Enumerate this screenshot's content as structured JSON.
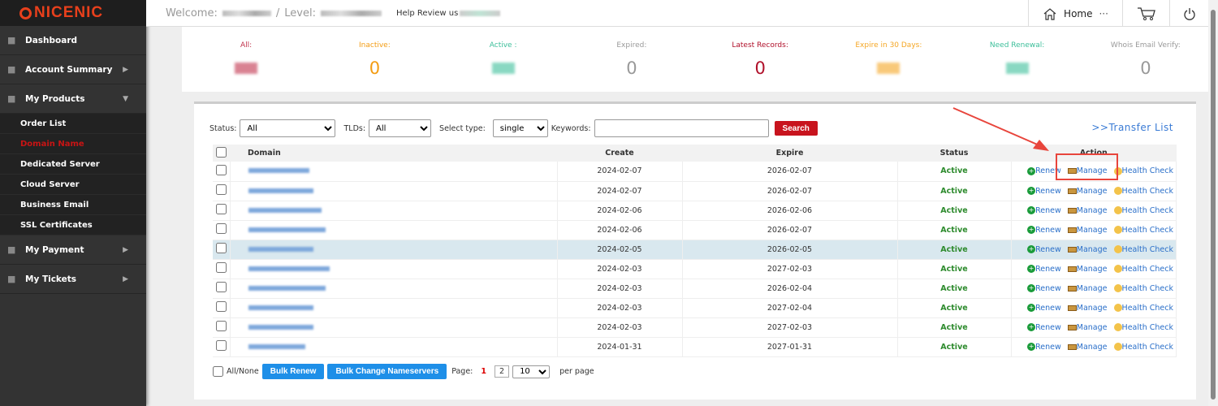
{
  "logo": "NICENIC",
  "header": {
    "welcome": "Welcome:",
    "level": "Level:",
    "help": "Help Review us",
    "home": "Home",
    "more": "···"
  },
  "sidebar": {
    "items": [
      {
        "label": "Dashboard",
        "icon": "monitor-icon"
      },
      {
        "label": "Account Summary",
        "icon": "user-icon"
      },
      {
        "label": "My Products",
        "icon": "basket-icon"
      }
    ],
    "sub": [
      "Order List",
      "Domain Name",
      "Dedicated Server",
      "Cloud Server",
      "Business Email",
      "SSL Certificates"
    ],
    "items2": [
      {
        "label": "My Payment",
        "icon": "money-bag-icon"
      },
      {
        "label": "My Tickets",
        "icon": "ticket-icon"
      }
    ]
  },
  "stats": [
    {
      "label": "All:",
      "value": null,
      "color": "#c0304a"
    },
    {
      "label": "Inactive:",
      "value": "0",
      "color": "#f39c12"
    },
    {
      "label": "Active :",
      "value": null,
      "color": "#3cbf9a"
    },
    {
      "label": "Expired:",
      "value": "0",
      "color": "#999999"
    },
    {
      "label": "Latest Records:",
      "value": "0",
      "color": "#b0102a"
    },
    {
      "label": "Expire in 30 Days:",
      "value": null,
      "color": "#f5a623"
    },
    {
      "label": "Need Renewal:",
      "value": null,
      "color": "#3cbf9a"
    },
    {
      "label": "Whois Email Verify:",
      "value": "0",
      "color": "#999999"
    }
  ],
  "filters": {
    "status_label": "Status:",
    "status": "All",
    "tlds_label": "TLDs:",
    "tlds": "All",
    "type_label": "Select type:",
    "type": "single",
    "keywords_label": "Keywords:",
    "keywords": "",
    "search": "Search",
    "transfer": ">>Transfer List"
  },
  "table": {
    "headers": [
      "Domain",
      "Create",
      "Expire",
      "Status",
      "Action"
    ],
    "rows": [
      {
        "create": "2024-02-07",
        "expire": "2026-02-07",
        "status": "Active"
      },
      {
        "create": "2024-02-07",
        "expire": "2026-02-07",
        "status": "Active"
      },
      {
        "create": "2024-02-06",
        "expire": "2026-02-06",
        "status": "Active"
      },
      {
        "create": "2024-02-06",
        "expire": "2026-02-07",
        "status": "Active"
      },
      {
        "create": "2024-02-05",
        "expire": "2026-02-05",
        "status": "Active"
      },
      {
        "create": "2024-02-03",
        "expire": "2027-02-03",
        "status": "Active"
      },
      {
        "create": "2024-02-03",
        "expire": "2026-02-04",
        "status": "Active"
      },
      {
        "create": "2024-02-03",
        "expire": "2027-02-04",
        "status": "Active"
      },
      {
        "create": "2024-02-03",
        "expire": "2027-02-03",
        "status": "Active"
      },
      {
        "create": "2024-01-31",
        "expire": "2027-01-31",
        "status": "Active"
      }
    ],
    "actions": {
      "renew": "Renew",
      "manage": "Manage",
      "health": "Health Check"
    }
  },
  "bottom": {
    "all_none": "All/None",
    "bulk_renew": "Bulk Renew",
    "bulk_ns": "Bulk Change Nameservers",
    "page_label": "Page:",
    "page_current": "1",
    "page_next": "2",
    "per_page_value": "10",
    "per_page": "per page"
  }
}
